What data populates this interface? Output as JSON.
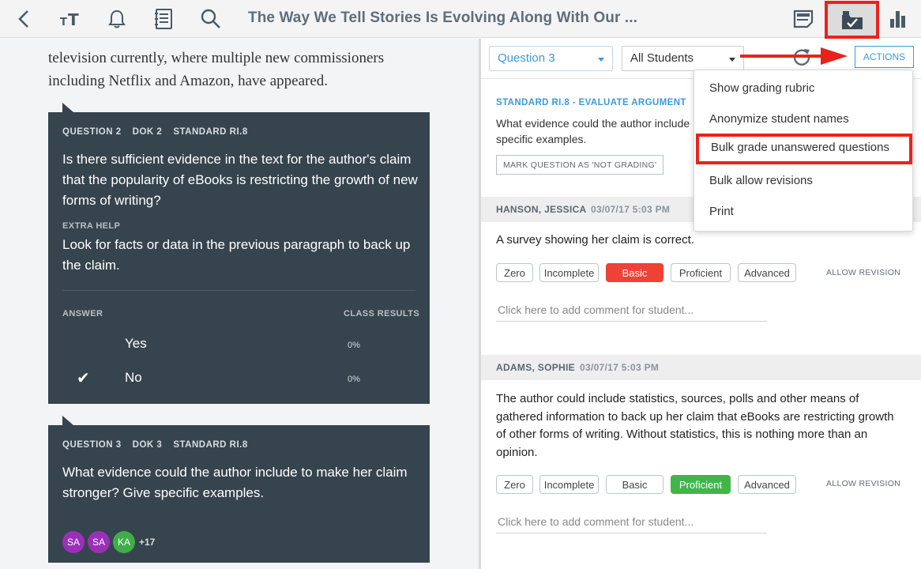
{
  "header": {
    "title": "The Way We Tell Stories Is Evolving Along With Our ...",
    "icons": [
      "back-icon",
      "text-size-icon",
      "bell-icon",
      "notebook-icon",
      "search-icon",
      "notes-icon",
      "grade-inbox-icon",
      "stats-icon"
    ]
  },
  "reading": {
    "line1": "television currently, where multiple new commissioners",
    "line2": "including Netflix and Amazon, have appeared."
  },
  "question2": {
    "number": "QUESTION 2",
    "dok": "DOK 2",
    "standard": "STANDARD RI.8",
    "text": "Is there sufficient evidence in the text for the author's claim that the popularity of eBooks is restricting the growth of new forms of writing?",
    "extra_help_label": "EXTRA HELP",
    "extra_help_text": "Look for facts or data in the previous paragraph to back up the claim.",
    "answer_header": "ANSWER",
    "results_header": "CLASS RESULTS",
    "answers": [
      {
        "label": "Yes",
        "pct": "0%",
        "checked": false
      },
      {
        "label": "No",
        "pct": "0%",
        "checked": true
      }
    ]
  },
  "question3": {
    "number": "QUESTION 3",
    "dok": "DOK 3",
    "standard": "STANDARD RI.8",
    "text": "What evidence could the author include to make her claim stronger? Give specific examples.",
    "avatars": [
      {
        "initials": "SA",
        "color": "#9b30b8"
      },
      {
        "initials": "SA",
        "color": "#9b30b8"
      },
      {
        "initials": "KA",
        "color": "#3fae49"
      }
    ],
    "more": "+17"
  },
  "grading": {
    "question_select": "Question 3",
    "students_select": "All Students",
    "actions_label": "ACTIONS",
    "standard_label": "STANDARD RI.8 - EVALUATE ARGUMENT",
    "prompt_line1": "What evidence could the author include",
    "prompt_line2": "specific examples.",
    "mark_button": "MARK QUESTION AS 'NOT GRADING'",
    "grade_options": [
      "Zero",
      "Incomplete",
      "Basic",
      "Proficient",
      "Advanced"
    ],
    "allow_revision": "ALLOW REVISION",
    "comment_placeholder": "Click here to add comment for student...",
    "students": [
      {
        "name": "HANSON, JESSICA",
        "date": "03/07/17 5:03 PM",
        "answer": "A survey showing her claim is correct.",
        "selected": "Basic"
      },
      {
        "name": "ADAMS, SOPHIE",
        "date": "03/07/17 5:03 PM",
        "answer": "The author could include statistics, sources, polls and other means of gathered information to back up her claim that eBooks are restricting growth of other forms of writing. Without statistics, this is nothing more than an opinion.",
        "selected": "Proficient"
      }
    ]
  },
  "actions_menu": {
    "items": [
      {
        "label": "Show grading rubric",
        "highlighted": false
      },
      {
        "label": "Anonymize student names",
        "highlighted": false
      },
      {
        "label": "Bulk grade unanswered questions",
        "highlighted": true
      },
      {
        "label": "Bulk allow revisions",
        "highlighted": false
      },
      {
        "label": "Print",
        "highlighted": false
      }
    ]
  },
  "colors": {
    "accent_blue": "#3a9ad9",
    "card_dark": "#36444e",
    "basic_red": "#ef4136",
    "proficient_green": "#42b549",
    "annotation_red": "#e8231c"
  }
}
